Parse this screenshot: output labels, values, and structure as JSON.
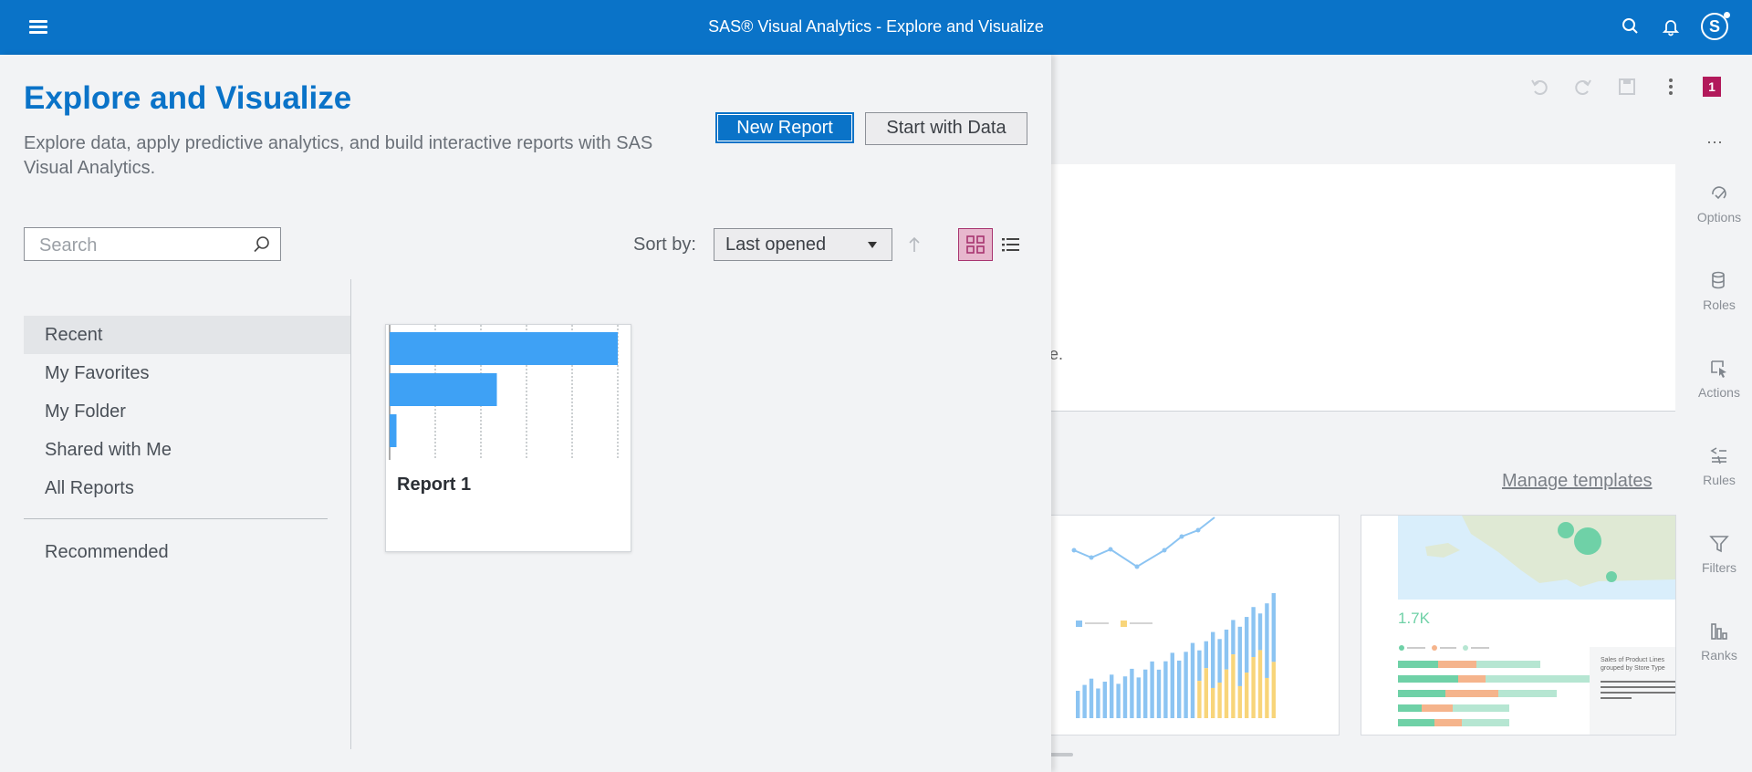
{
  "app": {
    "title": "SAS® Visual Analytics - Explore and Visualize",
    "user_initial": "S",
    "brand_color": "#0a73c8"
  },
  "panel": {
    "heading": "Explore and Visualize",
    "description": "Explore data, apply predictive analytics, and build interactive reports with SAS Visual Analytics.",
    "new_report_label": "New Report",
    "start_with_data_label": "Start with Data",
    "search_placeholder": "Search",
    "sort_label": "Sort by:",
    "sort_value": "Last opened",
    "nav": [
      {
        "label": "Recent",
        "active": true
      },
      {
        "label": "My Favorites"
      },
      {
        "label": "My Folder"
      },
      {
        "label": "Shared with Me"
      },
      {
        "label": "All Reports"
      }
    ],
    "recommended_label": "Recommended",
    "reports": [
      {
        "name": "Report 1",
        "bar_values": [
          1.0,
          0.47,
          0.03
        ]
      }
    ]
  },
  "workspace": {
    "badge": "1",
    "canvas_text_fragment": "e.",
    "manage_templates_label": "Manage templates",
    "template_kpi": "1.7K",
    "template_caption": "Sales of Product Lines grouped by Store Type",
    "rail": [
      {
        "label": "Options",
        "icon": "options-icon"
      },
      {
        "label": "Roles",
        "icon": "roles-icon"
      },
      {
        "label": "Actions",
        "icon": "actions-icon"
      },
      {
        "label": "Rules",
        "icon": "rules-icon"
      },
      {
        "label": "Filters",
        "icon": "filter-icon"
      },
      {
        "label": "Ranks",
        "icon": "ranks-icon"
      }
    ]
  }
}
